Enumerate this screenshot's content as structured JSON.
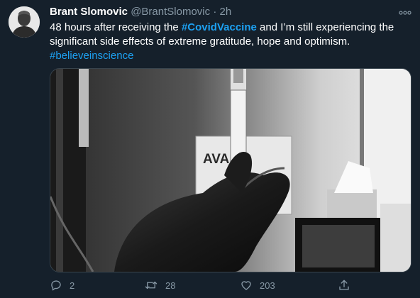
{
  "user": {
    "name": "Brant Slomovic",
    "handle": "@BrantSlomovic",
    "separator": "·",
    "time": "2h"
  },
  "tweet": {
    "text_1": "48 hours after receiving the ",
    "hashtag_1": "#CovidVaccine",
    "text_2": " and I’m still experiencing the significant side effects of extreme gratitude, hope and optimism.",
    "hashtag_2": "#believeinscience"
  },
  "media": {
    "sign_text": "AVAIL"
  },
  "actions": {
    "reply_count": "2",
    "retweet_count": "28",
    "like_count": "203"
  },
  "icons": [
    "more-icon",
    "reply-icon",
    "retweet-icon",
    "like-icon",
    "share-icon"
  ],
  "colors": {
    "background": "#15202b",
    "link": "#1da1f2",
    "muted": "#8899a6"
  }
}
